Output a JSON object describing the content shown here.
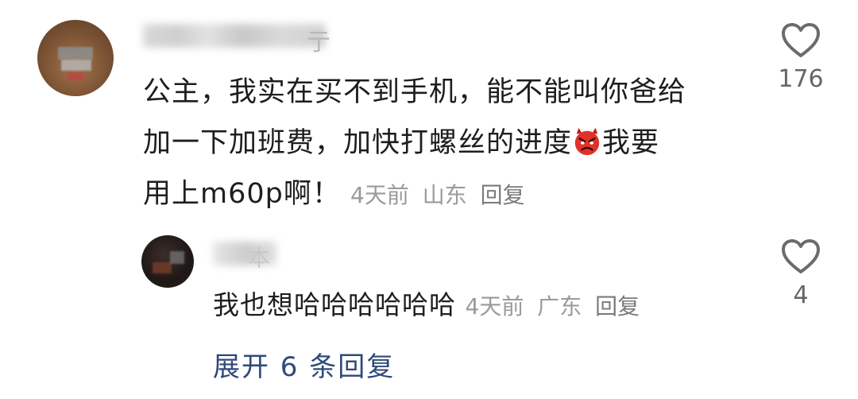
{
  "comment": {
    "text_line1": "公主，我实在买不到手机，能不能叫你爸给",
    "text_line2": "加一下加班费，加快打螺丝的进度",
    "text_line2_end": "我要",
    "text_line3": "用上m60p啊！",
    "time": "4天前",
    "location": "山东",
    "reply_label": "回复",
    "like_count": "176",
    "username_visible": "亍",
    "emoji_icon": "angry-devil-emoji"
  },
  "reply": {
    "username_visible": "本",
    "text": "我也想哈哈哈哈哈哈",
    "time": "4天前",
    "location": "广东",
    "reply_label": "回复",
    "like_count": "4"
  },
  "expand_label": "展开 6 条回复"
}
